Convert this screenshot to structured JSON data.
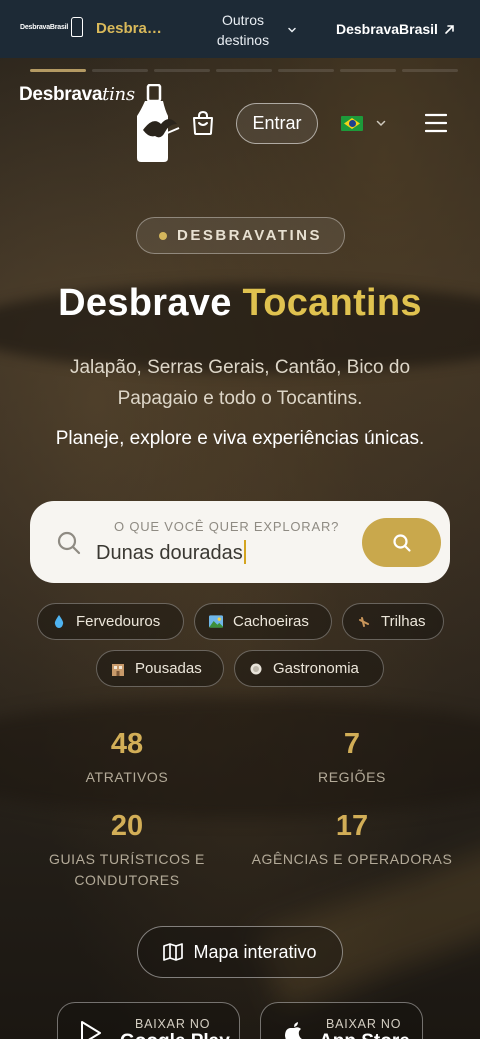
{
  "topbar": {
    "logo_text": "DesbravaBrasil",
    "active_label": "Desbravatins",
    "other_label": "Outros destinos",
    "brasil_label": "DesbravaBrasil"
  },
  "slides": {
    "count": 7,
    "active": 1
  },
  "header": {
    "brand_main": "Desbrava",
    "brand_italic": "tins",
    "login_label": "Entrar"
  },
  "hero": {
    "badge": "DESBRAVATINS",
    "title_plain": "Desbrave",
    "title_accent": "Tocantins",
    "subtitle": "Jalapão, Serras Gerais, Cantão, Bico do Papagaio e todo o Tocantins.",
    "tagline": "Planeje, explore e viva experiências únicas."
  },
  "search": {
    "label": "O QUE VOCÊ QUER EXPLORAR?",
    "value": "Dunas douradas"
  },
  "chips": [
    {
      "icon": "droplet-icon",
      "label": "Fervedouros"
    },
    {
      "icon": "landscape-icon",
      "label": "Cachoeiras"
    },
    {
      "icon": "hiking-icon",
      "label": "Trilhas"
    },
    {
      "icon": "hotel-icon",
      "label": "Pousadas"
    },
    {
      "icon": "dish-icon",
      "label": "Gastronomia"
    }
  ],
  "stats": [
    {
      "value": "48",
      "label": "ATRATIVOS"
    },
    {
      "value": "7",
      "label": "REGIÕES"
    },
    {
      "value": "20",
      "label": "GUIAS TURÍSTICOS E CONDUTORES"
    },
    {
      "value": "17",
      "label": "AGÊNCIAS E OPERADORAS"
    }
  ],
  "map_button": "Mapa interativo",
  "stores": [
    {
      "small": "BAIXAR NO",
      "big": "Google Play"
    },
    {
      "small": "BAIXAR NO",
      "big": "App Store"
    }
  ],
  "colors": {
    "accent": "#e0c24f",
    "gold_button": "#c9a84c",
    "topbar": "#1d2a36"
  }
}
